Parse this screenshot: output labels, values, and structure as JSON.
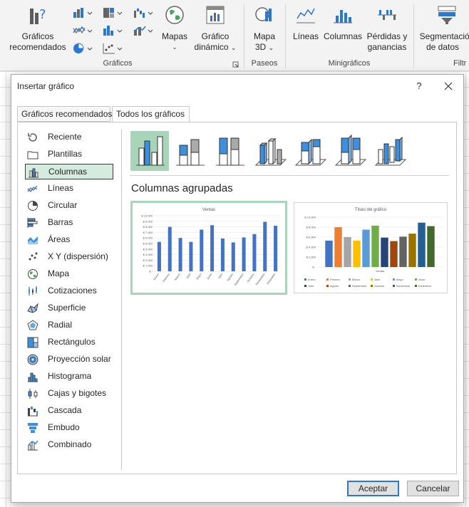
{
  "ribbon": {
    "recommended_line1": "Gráficos",
    "recommended_line2": "recomendados",
    "maps_label": "Mapas",
    "pivot_line1": "Gráfico",
    "pivot_line2": "dinámico",
    "graficos_group": "Gráficos",
    "map3d_line1": "Mapa",
    "map3d_line2": "3D",
    "paseos_group": "Paseos",
    "lineas": "Líneas",
    "columnas": "Columnas",
    "perdidas_line1": "Pérdidas y",
    "perdidas_line2": "ganancias",
    "minigraficos_group": "Minigráficos",
    "seg_line1": "Segmentación",
    "seg_line2": "de datos",
    "filtr_group": "Filtr"
  },
  "dialog": {
    "title": "Insertar gráfico",
    "help": "?",
    "tabs": [
      "Gráficos recomendados",
      "Todos los gráficos"
    ],
    "categories": [
      {
        "label": "Reciente",
        "icon": "recent-icon"
      },
      {
        "label": "Plantillas",
        "icon": "folder-icon"
      },
      {
        "label": "Columnas",
        "icon": "column-chart-icon"
      },
      {
        "label": "Líneas",
        "icon": "line-chart-icon"
      },
      {
        "label": "Circular",
        "icon": "pie-chart-icon"
      },
      {
        "label": "Barras",
        "icon": "bar-chart-icon"
      },
      {
        "label": "Áreas",
        "icon": "area-chart-icon"
      },
      {
        "label": "X Y (dispersión)",
        "icon": "scatter-chart-icon"
      },
      {
        "label": "Mapa",
        "icon": "map-globe-icon"
      },
      {
        "label": "Cotizaciones",
        "icon": "stock-chart-icon"
      },
      {
        "label": "Superficie",
        "icon": "surface-chart-icon"
      },
      {
        "label": "Radial",
        "icon": "radar-chart-icon"
      },
      {
        "label": "Rectángulos",
        "icon": "treemap-chart-icon"
      },
      {
        "label": "Proyección solar",
        "icon": "sunburst-chart-icon"
      },
      {
        "label": "Histograma",
        "icon": "histogram-chart-icon"
      },
      {
        "label": "Cajas y bigotes",
        "icon": "box-whisker-chart-icon"
      },
      {
        "label": "Cascada",
        "icon": "waterfall-chart-icon"
      },
      {
        "label": "Embudo",
        "icon": "funnel-chart-icon"
      },
      {
        "label": "Combinado",
        "icon": "combo-chart-icon"
      }
    ],
    "selected_category": "Columnas",
    "subtype_name": "Columnas agrupadas",
    "ok_label": "Aceptar",
    "cancel_label": "Cancelar"
  },
  "chart_data": [
    {
      "type": "bar",
      "title": "Ventas",
      "categories": [
        "Enero",
        "Febrero",
        "Marzo",
        "Abril",
        "Mayo",
        "Junio",
        "Julio",
        "Agosto",
        "Septiembre",
        "Octubre",
        "Noviembre",
        "Diciembre"
      ],
      "values": [
        5300,
        8000,
        6000,
        5300,
        7500,
        8300,
        5900,
        5200,
        6100,
        6700,
        8900,
        8200
      ],
      "ylim": [
        0,
        10000
      ],
      "yticks": [
        "$ 10.000",
        "$ 9.000",
        "$ 8.000",
        "$ 7.000",
        "$ 6.000",
        "$ 5.000",
        "$ 4.000",
        "$ 3.000",
        "$ 2.000",
        "$ 1.000",
        "$ -"
      ],
      "color": "#4472c4"
    },
    {
      "type": "bar",
      "title": "Título del gráfico",
      "xlabel": "Ventas",
      "series": [
        {
          "name": "Enero",
          "value": 5300,
          "color": "#4472c4"
        },
        {
          "name": "Febrero",
          "value": 8000,
          "color": "#ed7d31"
        },
        {
          "name": "Marzo",
          "value": 6000,
          "color": "#a5a5a5"
        },
        {
          "name": "Abril",
          "value": 5300,
          "color": "#ffc000"
        },
        {
          "name": "Mayo",
          "value": 7500,
          "color": "#5b9bd5"
        },
        {
          "name": "Junio",
          "value": 8300,
          "color": "#70ad47"
        },
        {
          "name": "Julio",
          "value": 5900,
          "color": "#264478"
        },
        {
          "name": "Agosto",
          "value": 5200,
          "color": "#9e480e"
        },
        {
          "name": "Septiembre",
          "value": 6100,
          "color": "#636363"
        },
        {
          "name": "Octubre",
          "value": 6700,
          "color": "#997300"
        },
        {
          "name": "Noviembre",
          "value": 8900,
          "color": "#255e91"
        },
        {
          "name": "Diciembre",
          "value": 8200,
          "color": "#43682b"
        }
      ],
      "ylim": [
        0,
        10000
      ],
      "yticks": [
        "$ 10.000",
        "$ 8.000",
        "$ 6.000",
        "$ 4.000",
        "$ 2.000",
        "$ -"
      ],
      "legend": "bottom"
    }
  ]
}
